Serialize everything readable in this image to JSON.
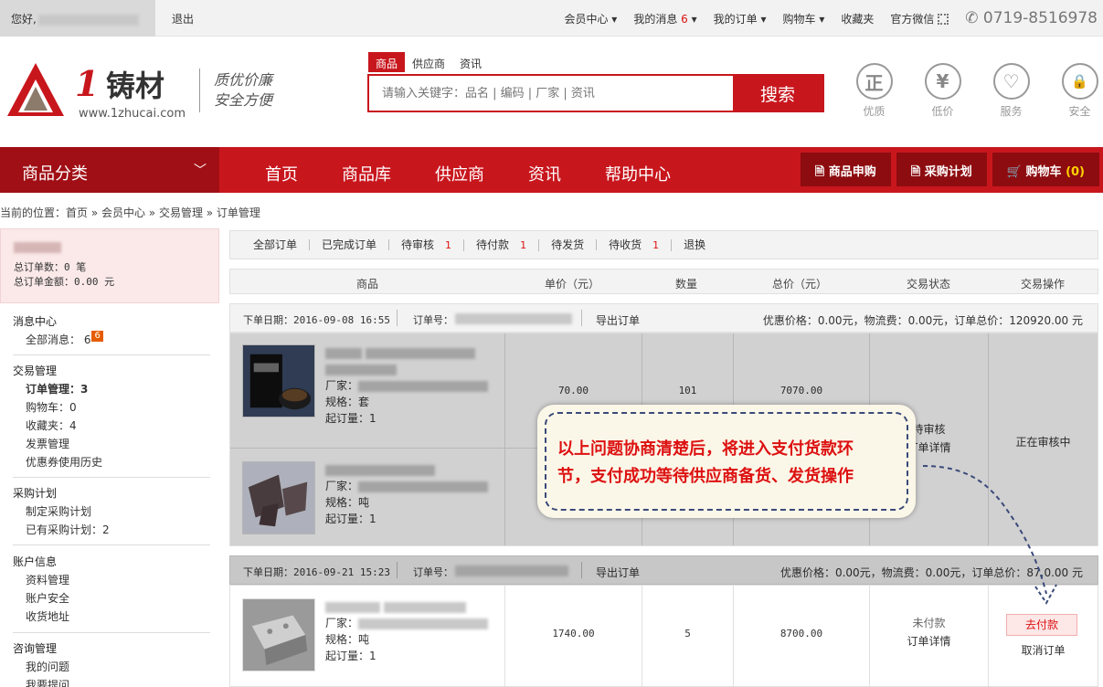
{
  "topbar": {
    "greeting": "您好,",
    "logout": "退出",
    "links": [
      "会员中心",
      "我的消息",
      "我的订单",
      "购物车",
      "收藏夹",
      "官方微信"
    ],
    "msg_count": "6",
    "phone": "0719-8516978"
  },
  "header": {
    "logo_num": "1",
    "logo_cn": "铸材",
    "logo_url": "www.1zhucai.com",
    "slogan1": "质优价廉",
    "slogan2": "安全方便",
    "search_tabs": [
      "商品",
      "供应商",
      "资讯"
    ],
    "search_placeholder": "请输入关键字：品名 | 编码 | 厂家 | 资讯",
    "search_btn": "搜索",
    "badges": [
      {
        "glyph": "正",
        "label": "优质"
      },
      {
        "glyph": "¥",
        "label": "低价"
      },
      {
        "glyph": "♡",
        "label": "服务"
      },
      {
        "glyph": "🔒",
        "label": "安全"
      }
    ]
  },
  "nav": {
    "category": "商品分类",
    "items": [
      "首页",
      "商品库",
      "供应商",
      "资讯",
      "帮助中心"
    ],
    "btn_purchase": "商品申购",
    "btn_plan": "采购计划",
    "btn_cart": "购物车",
    "cart_count": "(0)"
  },
  "breadcrumb": "当前的位置：首页 » 会员中心 » 交易管理 » 订单管理",
  "sidebar": {
    "total_orders": "总订单数：0 笔",
    "total_amount": "总订单金额：0.00 元",
    "msg_title": "消息中心",
    "msg_all": "全部消息：",
    "msg_count": "6",
    "msg_badge": "6",
    "trade_title": "交易管理",
    "order_mgmt": "订单管理：",
    "order_count": "3",
    "cart": "购物车：0",
    "fav": "收藏夹：4",
    "invoice": "发票管理",
    "coupon": "优惠券使用历史",
    "plan_title": "采购计划",
    "plan_make": "制定采购计划",
    "plan_have": "已有采购计划：2",
    "acct_title": "账户信息",
    "acct_data": "资料管理",
    "acct_sec": "账户安全",
    "acct_addr": "收货地址",
    "consult_title": "咨询管理",
    "consult_q": "我的问题",
    "consult_ask": "我要提问"
  },
  "tabs": [
    {
      "label": "全部订单",
      "count": ""
    },
    {
      "label": "已完成订单",
      "count": ""
    },
    {
      "label": "待审核",
      "count": "1"
    },
    {
      "label": "待付款",
      "count": "1"
    },
    {
      "label": "待发货",
      "count": ""
    },
    {
      "label": "待收货",
      "count": "1"
    },
    {
      "label": "退换",
      "count": ""
    }
  ],
  "columns": [
    "商品",
    "单价（元）",
    "数量",
    "总价（元）",
    "交易状态",
    "交易操作"
  ],
  "order1": {
    "date_label": "下单日期：2016-09-08 16:55",
    "no_label": "订单号：",
    "export": "导出订单",
    "summary": "优惠价格：0.00元，物流费：0.00元，订单总价：120920.00 元",
    "items": [
      {
        "maker": "厂家：",
        "spec": "规格：套",
        "min": "起订量：1",
        "price": "70.00",
        "qty": "101",
        "total": "7070.00"
      },
      {
        "maker": "厂家：",
        "spec": "规格：吨",
        "min": "起订量：1"
      }
    ],
    "status": "待审核",
    "detail": "订单详情",
    "op": "正在审核中"
  },
  "order2": {
    "date_label": "下单日期：2016-09-21 15:23",
    "no_label": "订单号：",
    "export": "导出订单",
    "summary": "优惠价格：0.00元，物流费：0.00元，订单总价：87.0.00 元",
    "items": [
      {
        "maker": "厂家：",
        "spec": "规格：吨",
        "min": "起订量：1",
        "price": "1740.00",
        "qty": "5",
        "total": "8700.00"
      }
    ],
    "status": "未付款",
    "detail": "订单详情",
    "pay": "去付款",
    "cancel": "取消订单"
  },
  "callout": {
    "line1": "以上问题协商清楚后，将进入支付货款环",
    "line2": "节，支付成功等待供应商备货、发货操作"
  }
}
